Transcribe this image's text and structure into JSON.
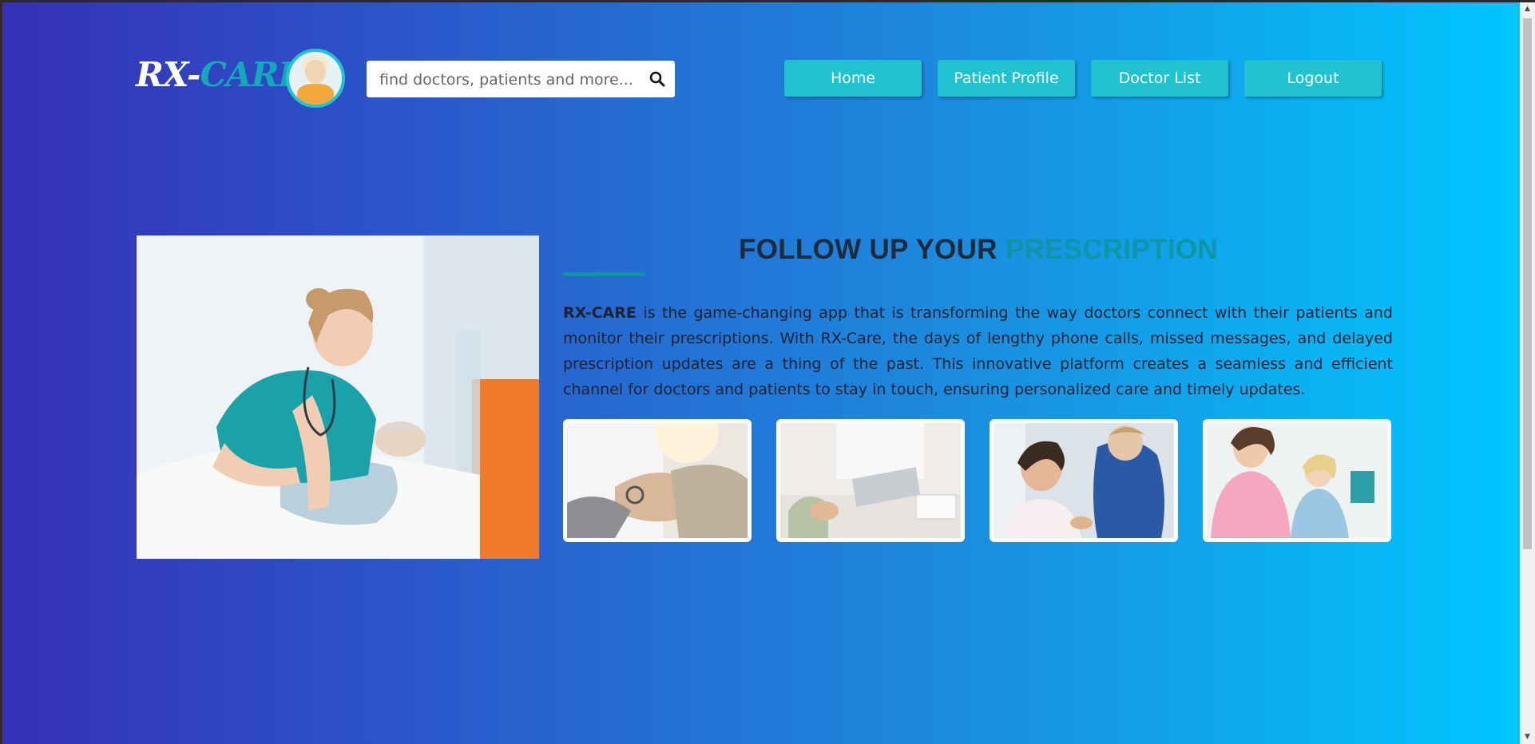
{
  "header": {
    "logo_part1": "RX-",
    "logo_part2": "CARE",
    "search_placeholder": "find doctors, patients and more...",
    "nav": [
      {
        "label": "Home"
      },
      {
        "label": "Patient Profile"
      },
      {
        "label": "Doctor List"
      },
      {
        "label": "Logout"
      }
    ]
  },
  "hero": {
    "heading_part1": "FOLLOW UP YOUR",
    "heading_part2": "PRESCRIPTION",
    "description_bold": "RX-CARE",
    "description_rest": " is the game-changing app that is transforming the way doctors connect with their patients and monitor their prescriptions. With RX-Care, the days of lengthy phone calls, missed messages, and delayed prescription updates are a thing of the past. This innovative platform creates a seamless and efficient channel for doctors and patients to stay in touch, ensuring personalized care and timely updates."
  },
  "colors": {
    "accent": "#0f96a4",
    "nav_button": "#20c2d0",
    "gradient_start": "#3530b6",
    "gradient_end": "#00c6ff"
  },
  "icons": {
    "search": "search-icon"
  }
}
